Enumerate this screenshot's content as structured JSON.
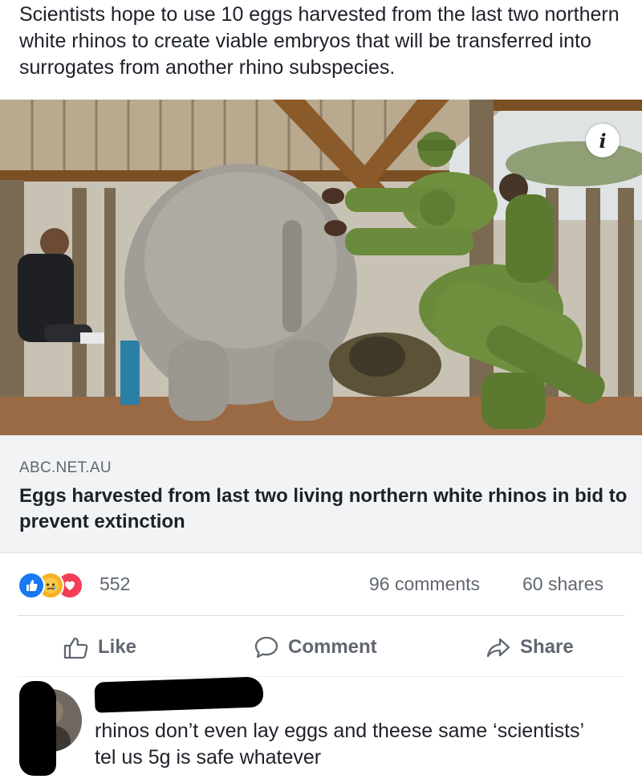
{
  "post": {
    "text": "Scientists hope to use 10 eggs harvested from the last two northern white rhinos to create viable embryos that will be transferred into surrogates from another rhino subspecies."
  },
  "link_preview": {
    "info_icon": "info-icon",
    "domain": "ABC.NET.AU",
    "title": "Eggs harvested from last two living northern white rhinos in bid to prevent extinction"
  },
  "engagement": {
    "reaction_icons": [
      "like-reaction-icon",
      "sad-reaction-icon",
      "love-reaction-icon"
    ],
    "reaction_count": "552",
    "comments": "96 comments",
    "shares": "60 shares"
  },
  "actions": {
    "like_label": "Like",
    "comment_label": "Comment",
    "share_label": "Share"
  },
  "comment": {
    "text": "rhinos don’t even lay eggs and theese same ‘scientists’ tel us 5g is safe whatever"
  },
  "colors": {
    "like_blue": "#1877f2",
    "sad_yellow": "#f7b125",
    "love_red": "#f33e58",
    "secondary_text": "#606770",
    "link_box_bg": "#f2f3f5"
  }
}
